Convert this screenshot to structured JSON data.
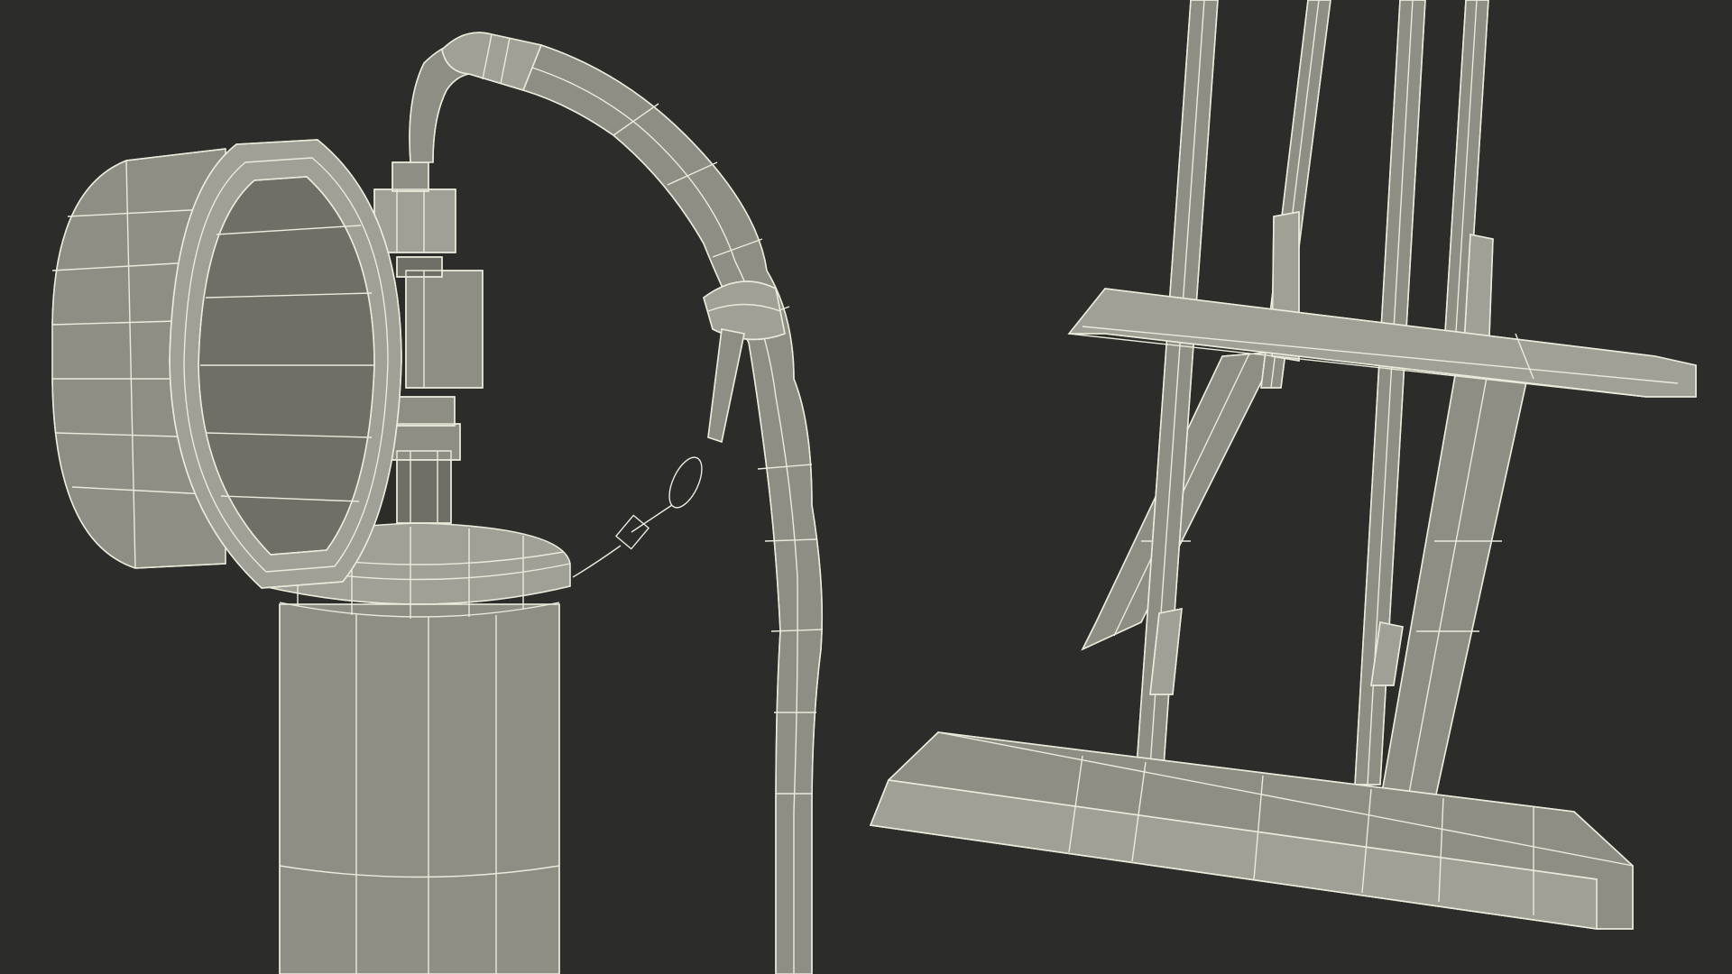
{
  "scene": {
    "background": "#2c2c2a",
    "surface_fill": "#8e8e84",
    "surface_fill_light": "#a0a096",
    "surface_fill_dark": "#6f6f67",
    "wire_color": "#ebebdc",
    "objects": [
      {
        "name": "grease-pump",
        "parts": [
          "pressure-gauge",
          "pump-head",
          "hose",
          "hose-clip",
          "chain",
          "cylinder"
        ]
      },
      {
        "name": "pump-stand",
        "parts": [
          "upright-rods",
          "top-crossbar",
          "braces",
          "base-plate"
        ]
      }
    ]
  }
}
